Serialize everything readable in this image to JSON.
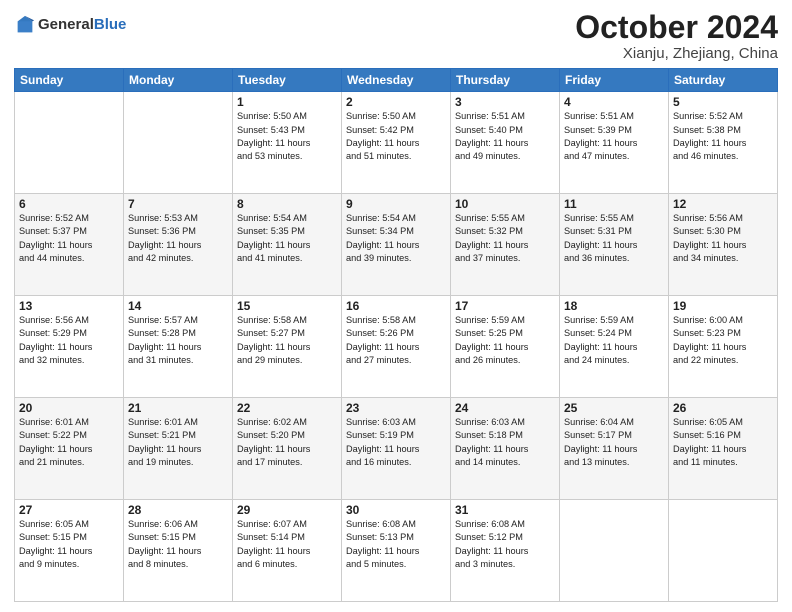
{
  "header": {
    "logo_general": "General",
    "logo_blue": "Blue",
    "month_title": "October 2024",
    "location": "Xianju, Zhejiang, China"
  },
  "weekdays": [
    "Sunday",
    "Monday",
    "Tuesday",
    "Wednesday",
    "Thursday",
    "Friday",
    "Saturday"
  ],
  "weeks": [
    [
      {
        "day": "",
        "info": ""
      },
      {
        "day": "",
        "info": ""
      },
      {
        "day": "1",
        "info": "Sunrise: 5:50 AM\nSunset: 5:43 PM\nDaylight: 11 hours\nand 53 minutes."
      },
      {
        "day": "2",
        "info": "Sunrise: 5:50 AM\nSunset: 5:42 PM\nDaylight: 11 hours\nand 51 minutes."
      },
      {
        "day": "3",
        "info": "Sunrise: 5:51 AM\nSunset: 5:40 PM\nDaylight: 11 hours\nand 49 minutes."
      },
      {
        "day": "4",
        "info": "Sunrise: 5:51 AM\nSunset: 5:39 PM\nDaylight: 11 hours\nand 47 minutes."
      },
      {
        "day": "5",
        "info": "Sunrise: 5:52 AM\nSunset: 5:38 PM\nDaylight: 11 hours\nand 46 minutes."
      }
    ],
    [
      {
        "day": "6",
        "info": "Sunrise: 5:52 AM\nSunset: 5:37 PM\nDaylight: 11 hours\nand 44 minutes."
      },
      {
        "day": "7",
        "info": "Sunrise: 5:53 AM\nSunset: 5:36 PM\nDaylight: 11 hours\nand 42 minutes."
      },
      {
        "day": "8",
        "info": "Sunrise: 5:54 AM\nSunset: 5:35 PM\nDaylight: 11 hours\nand 41 minutes."
      },
      {
        "day": "9",
        "info": "Sunrise: 5:54 AM\nSunset: 5:34 PM\nDaylight: 11 hours\nand 39 minutes."
      },
      {
        "day": "10",
        "info": "Sunrise: 5:55 AM\nSunset: 5:32 PM\nDaylight: 11 hours\nand 37 minutes."
      },
      {
        "day": "11",
        "info": "Sunrise: 5:55 AM\nSunset: 5:31 PM\nDaylight: 11 hours\nand 36 minutes."
      },
      {
        "day": "12",
        "info": "Sunrise: 5:56 AM\nSunset: 5:30 PM\nDaylight: 11 hours\nand 34 minutes."
      }
    ],
    [
      {
        "day": "13",
        "info": "Sunrise: 5:56 AM\nSunset: 5:29 PM\nDaylight: 11 hours\nand 32 minutes."
      },
      {
        "day": "14",
        "info": "Sunrise: 5:57 AM\nSunset: 5:28 PM\nDaylight: 11 hours\nand 31 minutes."
      },
      {
        "day": "15",
        "info": "Sunrise: 5:58 AM\nSunset: 5:27 PM\nDaylight: 11 hours\nand 29 minutes."
      },
      {
        "day": "16",
        "info": "Sunrise: 5:58 AM\nSunset: 5:26 PM\nDaylight: 11 hours\nand 27 minutes."
      },
      {
        "day": "17",
        "info": "Sunrise: 5:59 AM\nSunset: 5:25 PM\nDaylight: 11 hours\nand 26 minutes."
      },
      {
        "day": "18",
        "info": "Sunrise: 5:59 AM\nSunset: 5:24 PM\nDaylight: 11 hours\nand 24 minutes."
      },
      {
        "day": "19",
        "info": "Sunrise: 6:00 AM\nSunset: 5:23 PM\nDaylight: 11 hours\nand 22 minutes."
      }
    ],
    [
      {
        "day": "20",
        "info": "Sunrise: 6:01 AM\nSunset: 5:22 PM\nDaylight: 11 hours\nand 21 minutes."
      },
      {
        "day": "21",
        "info": "Sunrise: 6:01 AM\nSunset: 5:21 PM\nDaylight: 11 hours\nand 19 minutes."
      },
      {
        "day": "22",
        "info": "Sunrise: 6:02 AM\nSunset: 5:20 PM\nDaylight: 11 hours\nand 17 minutes."
      },
      {
        "day": "23",
        "info": "Sunrise: 6:03 AM\nSunset: 5:19 PM\nDaylight: 11 hours\nand 16 minutes."
      },
      {
        "day": "24",
        "info": "Sunrise: 6:03 AM\nSunset: 5:18 PM\nDaylight: 11 hours\nand 14 minutes."
      },
      {
        "day": "25",
        "info": "Sunrise: 6:04 AM\nSunset: 5:17 PM\nDaylight: 11 hours\nand 13 minutes."
      },
      {
        "day": "26",
        "info": "Sunrise: 6:05 AM\nSunset: 5:16 PM\nDaylight: 11 hours\nand 11 minutes."
      }
    ],
    [
      {
        "day": "27",
        "info": "Sunrise: 6:05 AM\nSunset: 5:15 PM\nDaylight: 11 hours\nand 9 minutes."
      },
      {
        "day": "28",
        "info": "Sunrise: 6:06 AM\nSunset: 5:15 PM\nDaylight: 11 hours\nand 8 minutes."
      },
      {
        "day": "29",
        "info": "Sunrise: 6:07 AM\nSunset: 5:14 PM\nDaylight: 11 hours\nand 6 minutes."
      },
      {
        "day": "30",
        "info": "Sunrise: 6:08 AM\nSunset: 5:13 PM\nDaylight: 11 hours\nand 5 minutes."
      },
      {
        "day": "31",
        "info": "Sunrise: 6:08 AM\nSunset: 5:12 PM\nDaylight: 11 hours\nand 3 minutes."
      },
      {
        "day": "",
        "info": ""
      },
      {
        "day": "",
        "info": ""
      }
    ]
  ]
}
